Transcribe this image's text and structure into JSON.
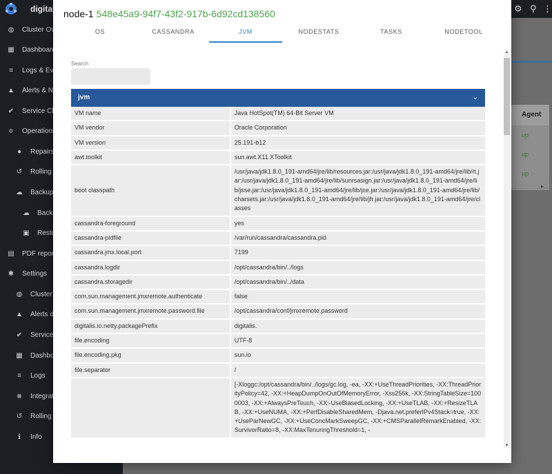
{
  "app": {
    "title": "digitalis",
    "sidebar": [
      {
        "label": "Cluster Overview",
        "icon": "globe-icon",
        "glyph": "◍",
        "indent": 0
      },
      {
        "label": "Dashboards",
        "icon": "dashboard-icon",
        "glyph": "▦",
        "indent": 0
      },
      {
        "label": "Logs & Events",
        "icon": "list-icon",
        "glyph": "≡",
        "indent": 0
      },
      {
        "label": "Alerts & Notifications",
        "icon": "bell-icon",
        "glyph": "▲",
        "indent": 0
      },
      {
        "label": "Service Checks",
        "icon": "check-icon",
        "glyph": "✔",
        "indent": 0
      },
      {
        "label": "Operations",
        "icon": "sliders-icon",
        "glyph": "≑",
        "indent": 0
      },
      {
        "label": "Repairs",
        "icon": "repair-icon",
        "glyph": "●",
        "indent": 1
      },
      {
        "label": "Rolling restart",
        "icon": "history-icon",
        "glyph": "↺",
        "indent": 1
      },
      {
        "label": "Backups",
        "icon": "cloud-icon",
        "glyph": "☁",
        "indent": 1
      },
      {
        "label": "Backup",
        "icon": "cloud-upload-icon",
        "glyph": "☁",
        "indent": 2
      },
      {
        "label": "Restore",
        "icon": "file-icon",
        "glyph": "▣",
        "indent": 2
      },
      {
        "label": "PDF reports",
        "icon": "report-icon",
        "glyph": "▤",
        "indent": 0
      },
      {
        "label": "Settings",
        "icon": "gear-icon",
        "glyph": "✱",
        "indent": 0
      },
      {
        "label": "Cluster",
        "icon": "globe-icon",
        "glyph": "◍",
        "indent": 1
      },
      {
        "label": "Alerts destinations",
        "icon": "alert-icon",
        "glyph": "▲",
        "indent": 1
      },
      {
        "label": "Service checks",
        "icon": "check-icon",
        "glyph": "✔",
        "indent": 1
      },
      {
        "label": "Dashboards",
        "icon": "dashboard-icon",
        "glyph": "▦",
        "indent": 1
      },
      {
        "label": "Logs",
        "icon": "list-icon",
        "glyph": "≡",
        "indent": 1
      },
      {
        "label": "Integrations",
        "icon": "integrations-icon",
        "glyph": "⧻",
        "indent": 1
      },
      {
        "label": "Rolling restart",
        "icon": "history-icon",
        "glyph": "↺",
        "indent": 1
      },
      {
        "label": "Info",
        "icon": "info-icon",
        "glyph": "ℹ",
        "indent": 1
      }
    ],
    "table_header": "Agent",
    "agent_status": [
      "up",
      "up",
      "up"
    ]
  },
  "modal": {
    "node_label": "node-1",
    "node_id": "548e45a9-94f7-43f2-917b-6d92cd138560",
    "tabs": [
      "OS",
      "CASSANDRA",
      "JVM",
      "NODESTATS",
      "TASKS",
      "NODETOOL"
    ],
    "active_tab": "JVM",
    "search_label": "Search",
    "search_value": "",
    "section_title": "jvm",
    "rows": [
      {
        "key": "VM name",
        "value": "Java HotSpot(TM) 64-Bit Server VM"
      },
      {
        "key": "VM vendor",
        "value": "Oracle Corporation"
      },
      {
        "key": "VM version",
        "value": "25.191-b12"
      },
      {
        "key": "awt.toolkit",
        "value": "sun.awt.X11.XToolkit"
      },
      {
        "key": "boot classpath",
        "value": "/usr/java/jdk1.8.0_191-amd64/jre/lib/resources.jar:/usr/java/jdk1.8.0_191-amd64/jre/lib/rt.jar:/usr/java/jdk1.8.0_191-amd64/jre/lib/sunrsasign.jar:/usr/java/jdk1.8.0_191-amd64/jre/lib/jsse.jar:/usr/java/jdk1.8.0_191-amd64/jre/lib/jce.jar:/usr/java/jdk1.8.0_191-amd64/jre/lib/charsets.jar:/usr/java/jdk1.8.0_191-amd64/jre/lib/jfr.jar:/usr/java/jdk1.8.0_191-amd64/jre/classes"
      },
      {
        "key": "cassandra-foreground",
        "value": "yes"
      },
      {
        "key": "cassandra-pidfile",
        "value": "/var/run/cassandra/cassandra.pid"
      },
      {
        "key": "cassandra.jmx.local.port",
        "value": "7199"
      },
      {
        "key": "cassandra.logdir",
        "value": "/opt/cassandra/bin/../logs"
      },
      {
        "key": "cassandra.storagedir",
        "value": "/opt/cassandra/bin/../data"
      },
      {
        "key": "com.sun.management.jmxremote.authenticate",
        "value": "false"
      },
      {
        "key": "com.sun.management.jmxremote.password.file",
        "value": "/opt/cassandra/conf/jmxremote.password"
      },
      {
        "key": "digitalis.io.netty.packagePrefix",
        "value": "digitalis."
      },
      {
        "key": "file.encoding",
        "value": "UTF-8"
      },
      {
        "key": "file.encoding.pkg",
        "value": "sun.io"
      },
      {
        "key": "file.separator",
        "value": "/"
      },
      {
        "key": "",
        "value": "[-Xloggc:/opt/cassandra/bin/../logs/gc.log, -ea, -XX:+UseThreadPriorities, -XX:ThreadPriorityPolicy=42, -XX:+HeapDumpOnOutOfMemoryError, -Xss256k, -XX:StringTableSize=1000003, -XX:+AlwaysPreTouch, -XX:-UseBiasedLocking, -XX:+UseTLAB, -XX:+ResizeTLAB, -XX:+UseNUMA, -XX:+PerfDisableSharedMem, -Djava.net.preferIPv4Stack=true, -XX:+UseParNewGC, -XX:+UseConcMarkSweepGC, -XX:+CMSParallelRemarkEnabled, -XX:SurvivorRatio=8, -XX:MaxTenuringThreshold=1, -"
      }
    ]
  },
  "colors": {
    "accent": "#2f82c8",
    "section_header": "#26589a",
    "node_id": "#4aa34a",
    "status_up": "#3b7a2e"
  }
}
